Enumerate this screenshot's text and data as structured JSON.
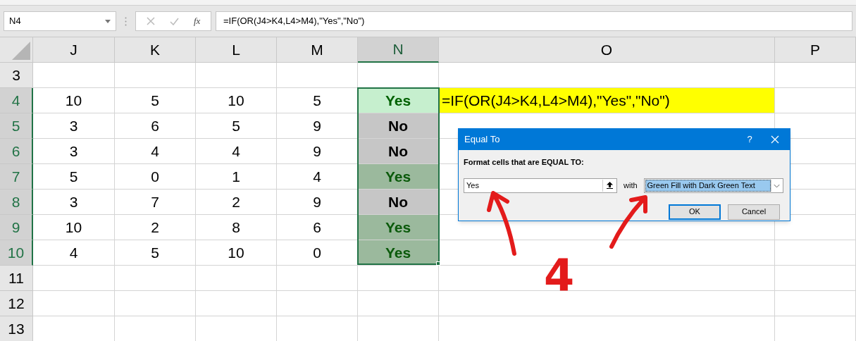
{
  "name_box": {
    "value": "N4"
  },
  "formula_bar": {
    "function_label": "fx",
    "formula": "=IF(OR(J4>K4,L4>M4),\"Yes\",\"No\")"
  },
  "columns": [
    {
      "label": "J",
      "selected": false
    },
    {
      "label": "K",
      "selected": false
    },
    {
      "label": "L",
      "selected": false
    },
    {
      "label": "M",
      "selected": false
    },
    {
      "label": "N",
      "selected": true
    },
    {
      "label": "O",
      "selected": false
    },
    {
      "label": "P",
      "selected": false
    }
  ],
  "rows": [
    {
      "header": "3",
      "selected": false
    },
    {
      "header": "4",
      "selected": true,
      "values": [
        "10",
        "5",
        "10",
        "5"
      ],
      "result": {
        "text": "Yes",
        "highlighted": true,
        "active": true
      },
      "formula_cell": {
        "text": "=IF(OR(J4>K4,L4>M4),\"Yes\",\"No\")",
        "highlighted": true
      }
    },
    {
      "header": "5",
      "selected": true,
      "values": [
        "3",
        "6",
        "5",
        "9"
      ],
      "result": {
        "text": "No",
        "highlighted": false,
        "active": false
      }
    },
    {
      "header": "6",
      "selected": true,
      "values": [
        "3",
        "4",
        "4",
        "9"
      ],
      "result": {
        "text": "No",
        "highlighted": false,
        "active": false
      }
    },
    {
      "header": "7",
      "selected": true,
      "values": [
        "5",
        "0",
        "1",
        "4"
      ],
      "result": {
        "text": "Yes",
        "highlighted": true,
        "active": false
      }
    },
    {
      "header": "8",
      "selected": true,
      "values": [
        "3",
        "7",
        "2",
        "9"
      ],
      "result": {
        "text": "No",
        "highlighted": false,
        "active": false
      }
    },
    {
      "header": "9",
      "selected": true,
      "values": [
        "10",
        "2",
        "8",
        "6"
      ],
      "result": {
        "text": "Yes",
        "highlighted": true,
        "active": false
      }
    },
    {
      "header": "10",
      "selected": true,
      "values": [
        "4",
        "5",
        "10",
        "0"
      ],
      "result": {
        "text": "Yes",
        "highlighted": true,
        "active": false
      }
    },
    {
      "header": "11",
      "selected": false
    },
    {
      "header": "12",
      "selected": false
    },
    {
      "header": "13",
      "selected": false
    }
  ],
  "dialog": {
    "title": "Equal To",
    "help": "?",
    "prompt": "Format cells that are EQUAL TO:",
    "value": "Yes",
    "with_label": "with",
    "format": "Green Fill with Dark Green Text",
    "buttons": [
      {
        "label": "OK",
        "default": true
      },
      {
        "label": "Cancel",
        "default": false
      }
    ]
  },
  "annotation": {
    "text": "4"
  }
}
